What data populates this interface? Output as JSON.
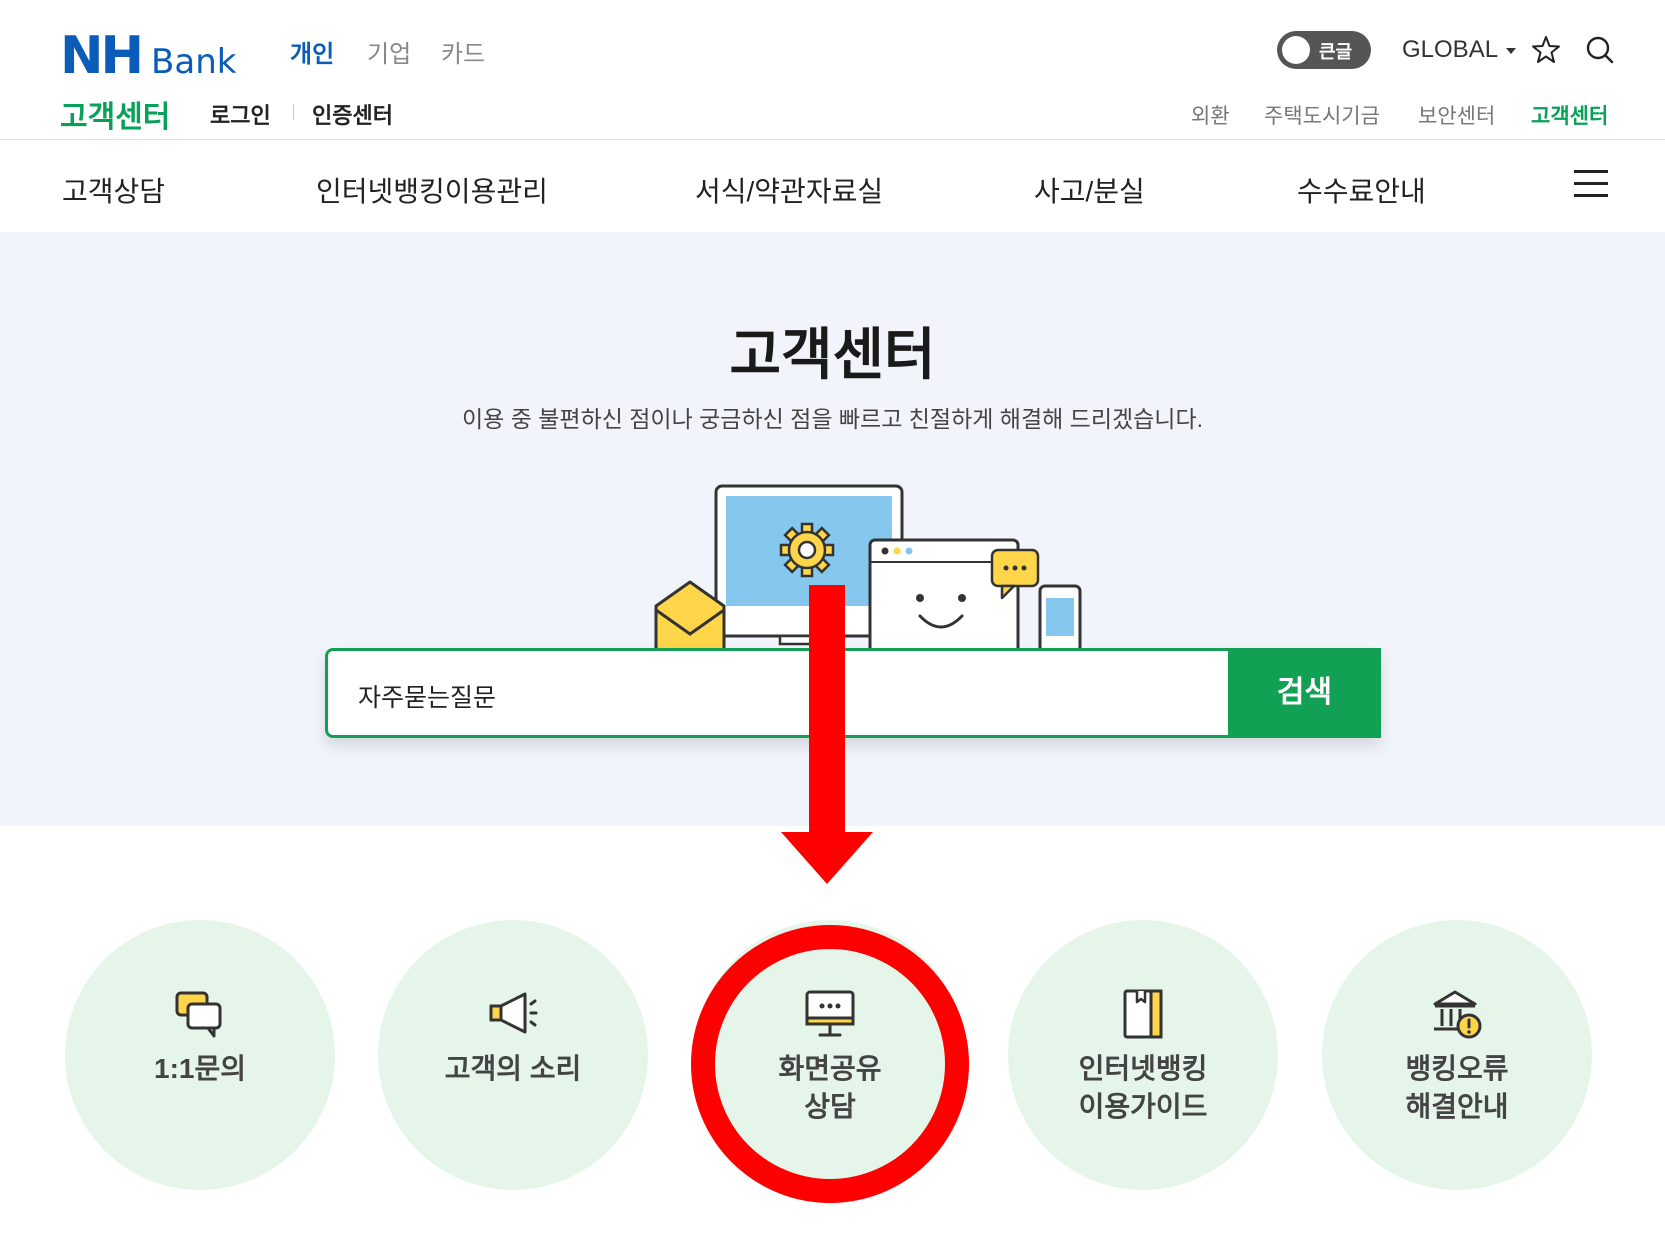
{
  "header": {
    "brand_nh": "NH",
    "brand_bank": "Bank",
    "segments": [
      "개인",
      "기업",
      "카드"
    ],
    "toggle_label": "큰글",
    "global_label": "GLOBAL",
    "section_title": "고객센터",
    "sub_links": [
      "로그인",
      "인증센터"
    ],
    "util_links": [
      "외환",
      "주택도시기금",
      "보안센터",
      "고객센터"
    ]
  },
  "nav": {
    "items": [
      "고객상담",
      "인터넷뱅킹이용관리",
      "서식/약관자료실",
      "사고/분실",
      "수수료안내"
    ]
  },
  "hero": {
    "title": "고객센터",
    "subtitle": "이용 중 불편하신 점이나 궁금하신 점을 빠르고 친절하게 해결해 드리겠습니다.",
    "search_value": "자주묻는질문",
    "search_button": "검색"
  },
  "services": [
    {
      "label": "1:1문의",
      "icon": "chat-bubbles-icon"
    },
    {
      "label": "고객의 소리",
      "icon": "megaphone-icon"
    },
    {
      "label": "화면공유\n상담",
      "icon": "monitor-chat-icon"
    },
    {
      "label": "인터넷뱅킹\n이용가이드",
      "icon": "book-icon"
    },
    {
      "label": "뱅킹오류\n해결안내",
      "icon": "bank-warning-icon"
    }
  ],
  "colors": {
    "brand_blue": "#0a5cb8",
    "brand_green": "#12a055",
    "circle_bg": "#e6f5ea",
    "annotation_red": "#ff0000"
  }
}
